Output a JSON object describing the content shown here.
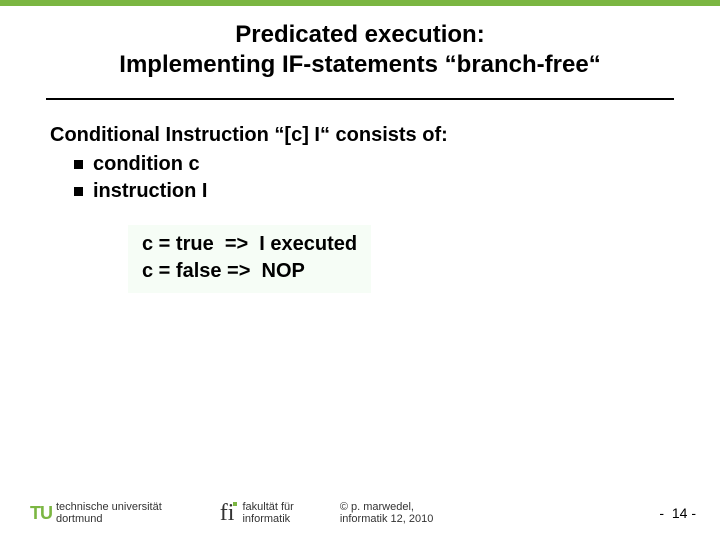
{
  "title": {
    "line1": "Predicated execution:",
    "line2": "Implementing IF-statements “branch-free“"
  },
  "body": {
    "lead": "Conditional Instruction “[c] I“ consists of:",
    "bullets": [
      "condition c",
      "instruction I"
    ],
    "code": [
      "c = true  =>  I executed",
      "c = false =>  NOP"
    ]
  },
  "footer": {
    "tu_label_line1": "technische universität",
    "tu_label_line2": "dortmund",
    "fi_label_line1": "fakultät für",
    "fi_label_line2": "informatik",
    "copyright_line1": "©  p. marwedel,",
    "copyright_line2": "informatik 12,  2010",
    "page": "-  14 -"
  }
}
